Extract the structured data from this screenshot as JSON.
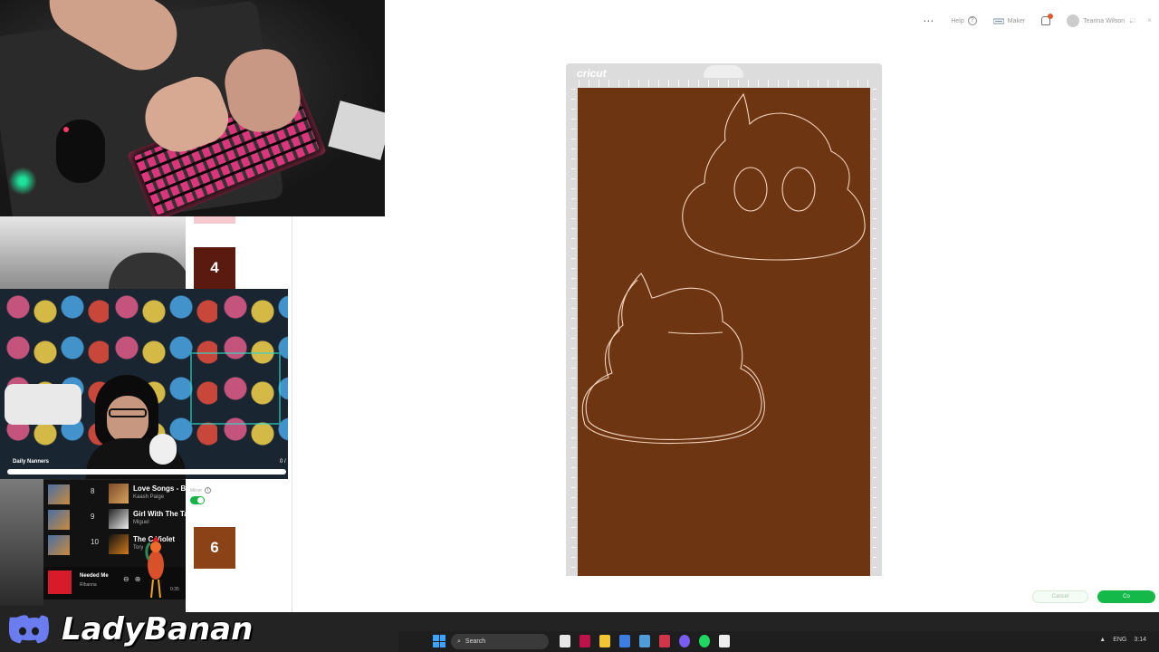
{
  "app": {
    "topbar": {
      "more_label": "⋯",
      "help_label": "Help",
      "help_icon": "?",
      "maker_label": "Maker",
      "user_label": "Tearina Wilson",
      "chevron": "⌄"
    },
    "window_controls": [
      "–",
      "□",
      "×"
    ],
    "mat": {
      "brand": "cricut",
      "material_color": "#6e3513",
      "mat_color": "#dcdcdc"
    },
    "buttons": {
      "cancel": "Cancel",
      "continue": "Co"
    },
    "accent_color": "#15b94a"
  },
  "mats_panel": {
    "items": [
      {
        "number": "4",
        "color": "#5b1a0f"
      },
      {
        "number": "6",
        "color": "#8a4216"
      }
    ],
    "mirror_label": "Mirror",
    "mirror_on": true
  },
  "stream": {
    "goal_label": "Daily Nanners",
    "goal_value": "0 /",
    "brand_name": "LadyBanan"
  },
  "playlist": {
    "tracks": [
      {
        "number": "8",
        "title": "Love Songs - Bo",
        "artist": "Kaash Paige"
      },
      {
        "number": "9",
        "title": "Girl With The Ta",
        "artist": "Miguel"
      },
      {
        "number": "10",
        "title": "The C  Violet",
        "artist": "Tory"
      }
    ],
    "now_playing": {
      "title": "Needed Me",
      "artist": "Rihanna",
      "time": "0:35"
    }
  },
  "taskbar": {
    "search_label": "Search",
    "tray_lang": "ENG",
    "time": "3:14"
  }
}
